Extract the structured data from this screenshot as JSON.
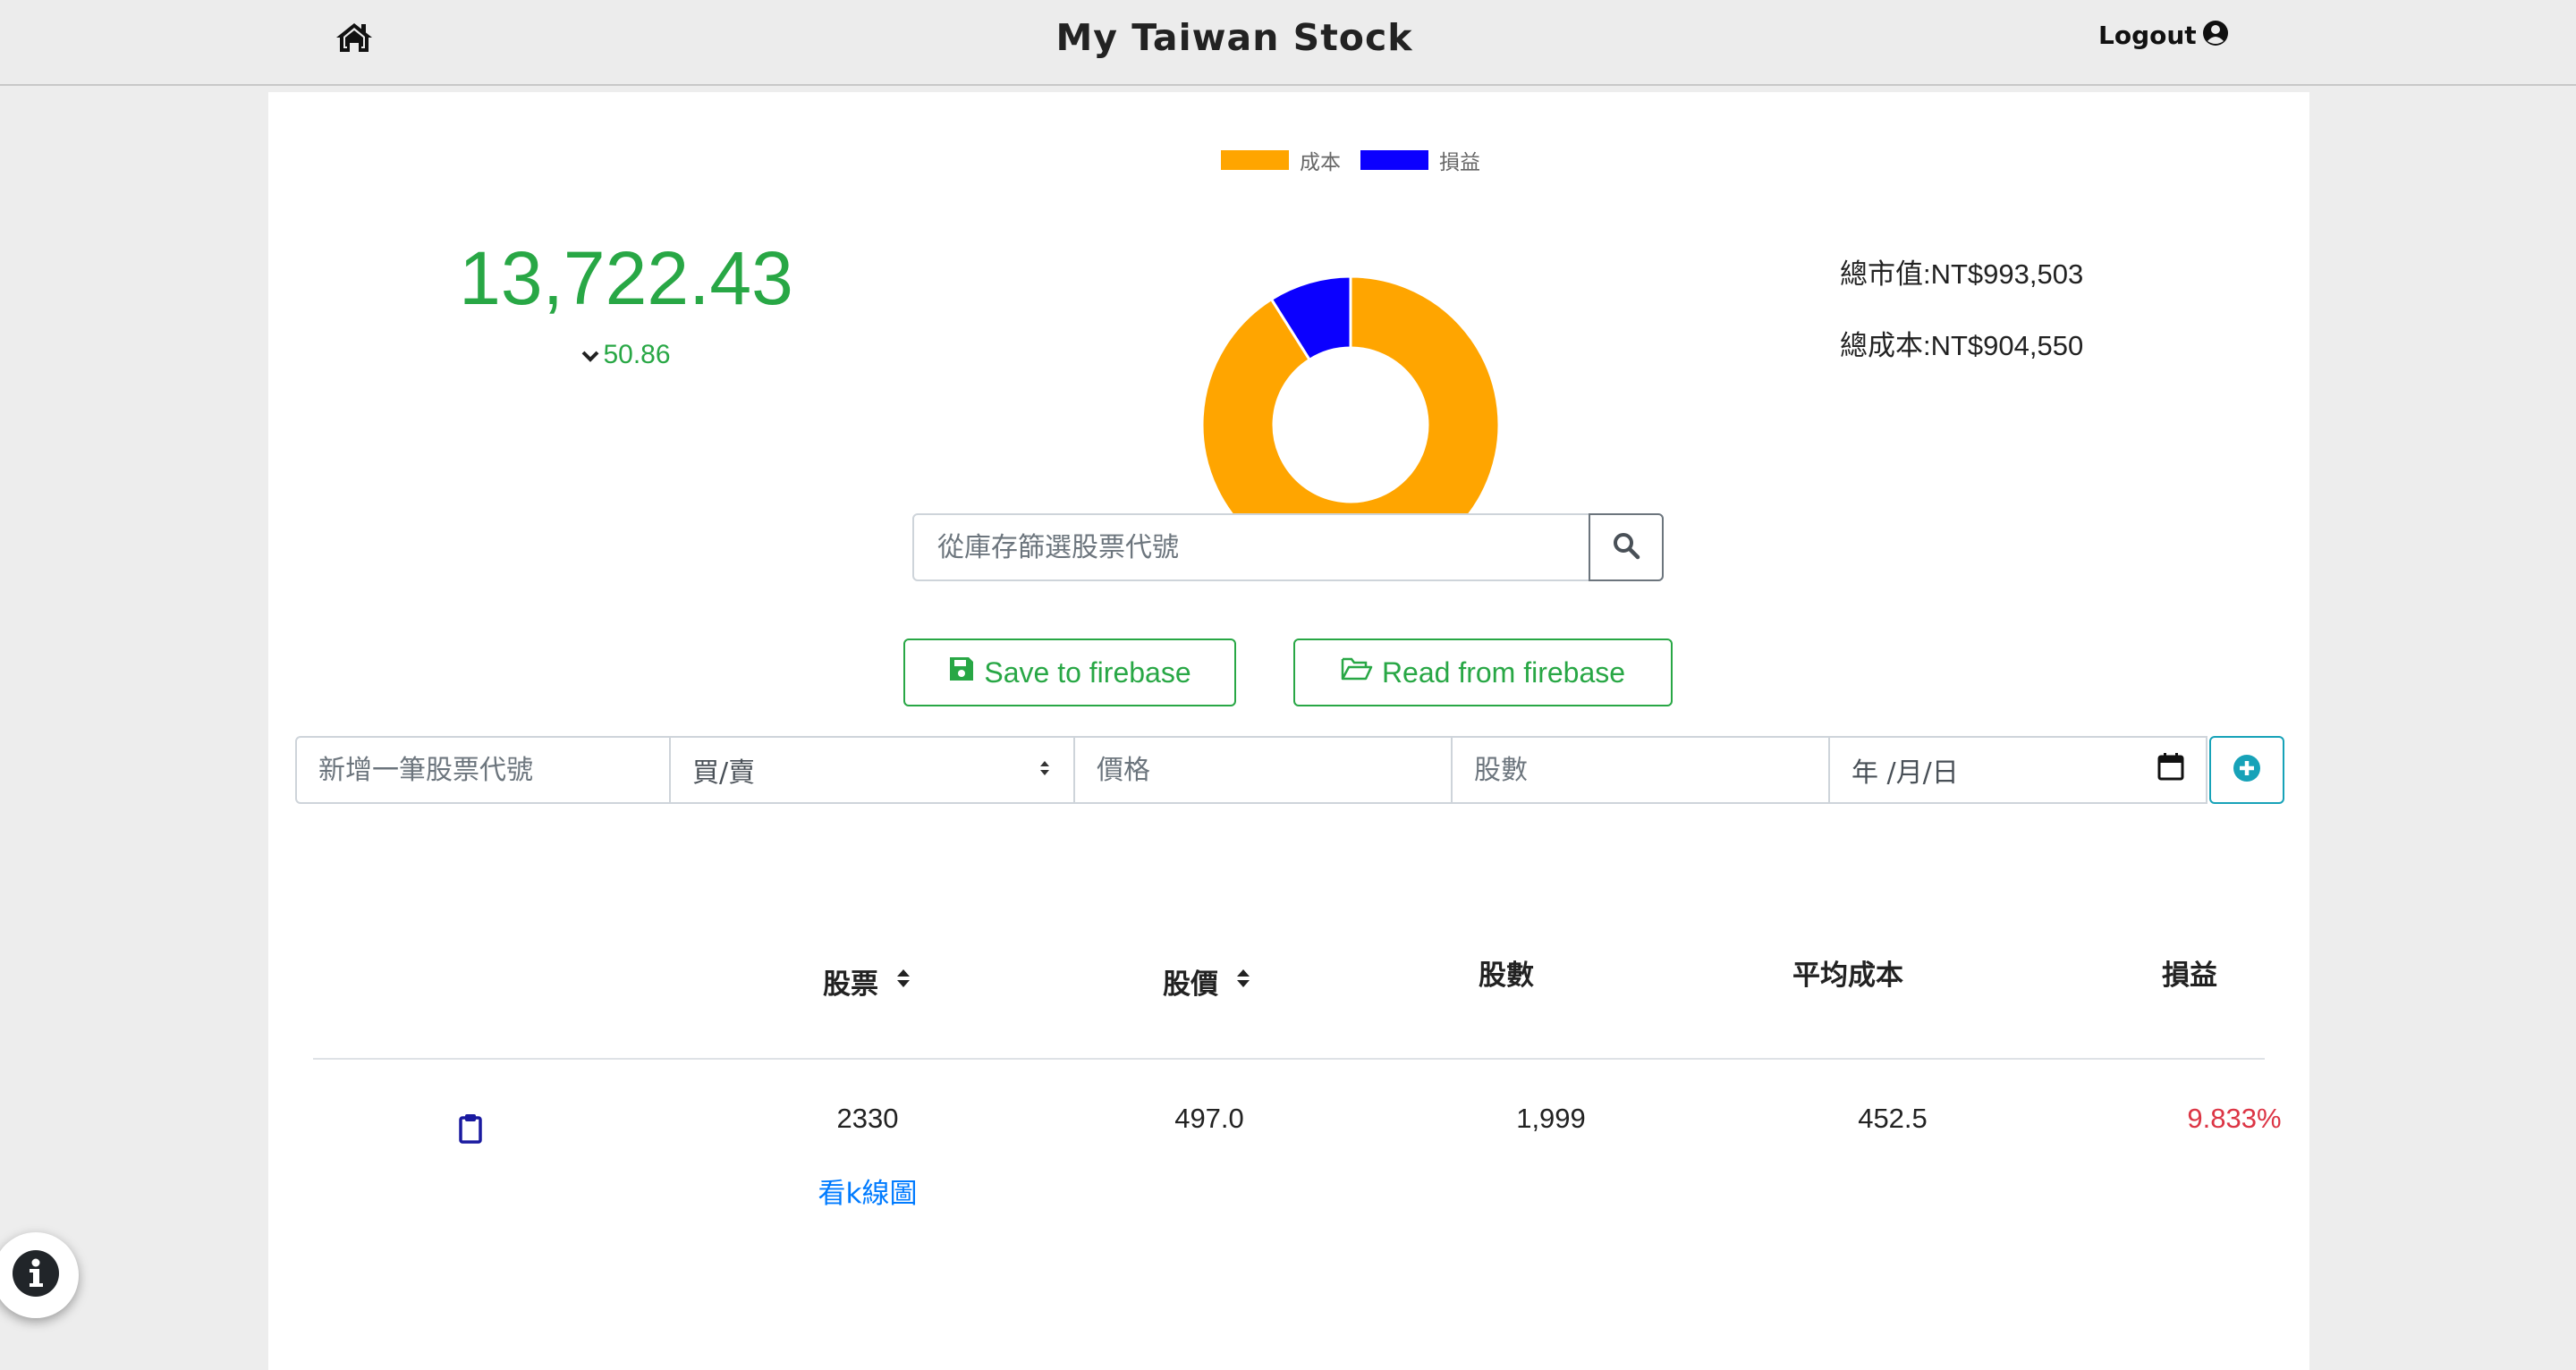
{
  "navbar": {
    "title": "My Taiwan Stock",
    "logout_label": "Logout",
    "icons": {
      "home": "home-icon",
      "user": "user-circle-icon"
    }
  },
  "index": {
    "value": "13,722.43",
    "change": "50.86",
    "direction": "down",
    "color": "#28a745"
  },
  "summary": {
    "market_value": "總市值:NT$993,503",
    "total_cost": "總成本:NT$904,550"
  },
  "chart_data": {
    "type": "pie",
    "categories": [
      "成本",
      "損益"
    ],
    "values": [
      904550,
      88953
    ],
    "colors": [
      "#ffa500",
      "#0b00ff"
    ],
    "legend_position": "top"
  },
  "search": {
    "placeholder": "從庫存篩選股票代號"
  },
  "firebase": {
    "save_label": "Save to firebase",
    "read_label": "Read from firebase"
  },
  "add_form": {
    "code_placeholder": "新增一筆股票代號",
    "type_value": "買/賣",
    "price_placeholder": "價格",
    "shares_placeholder": "股數",
    "date_placeholder": "年 /月/日"
  },
  "table": {
    "headers": {
      "stock": "股票",
      "price": "股價",
      "shares": "股數",
      "avg_cost": "平均成本",
      "pnl": "損益"
    },
    "rows": [
      {
        "stock": "2330",
        "price": "497.0",
        "shares": "1,999",
        "avg_cost": "452.5",
        "pnl": "9.833%",
        "kline_label": "看k線圖"
      }
    ]
  }
}
